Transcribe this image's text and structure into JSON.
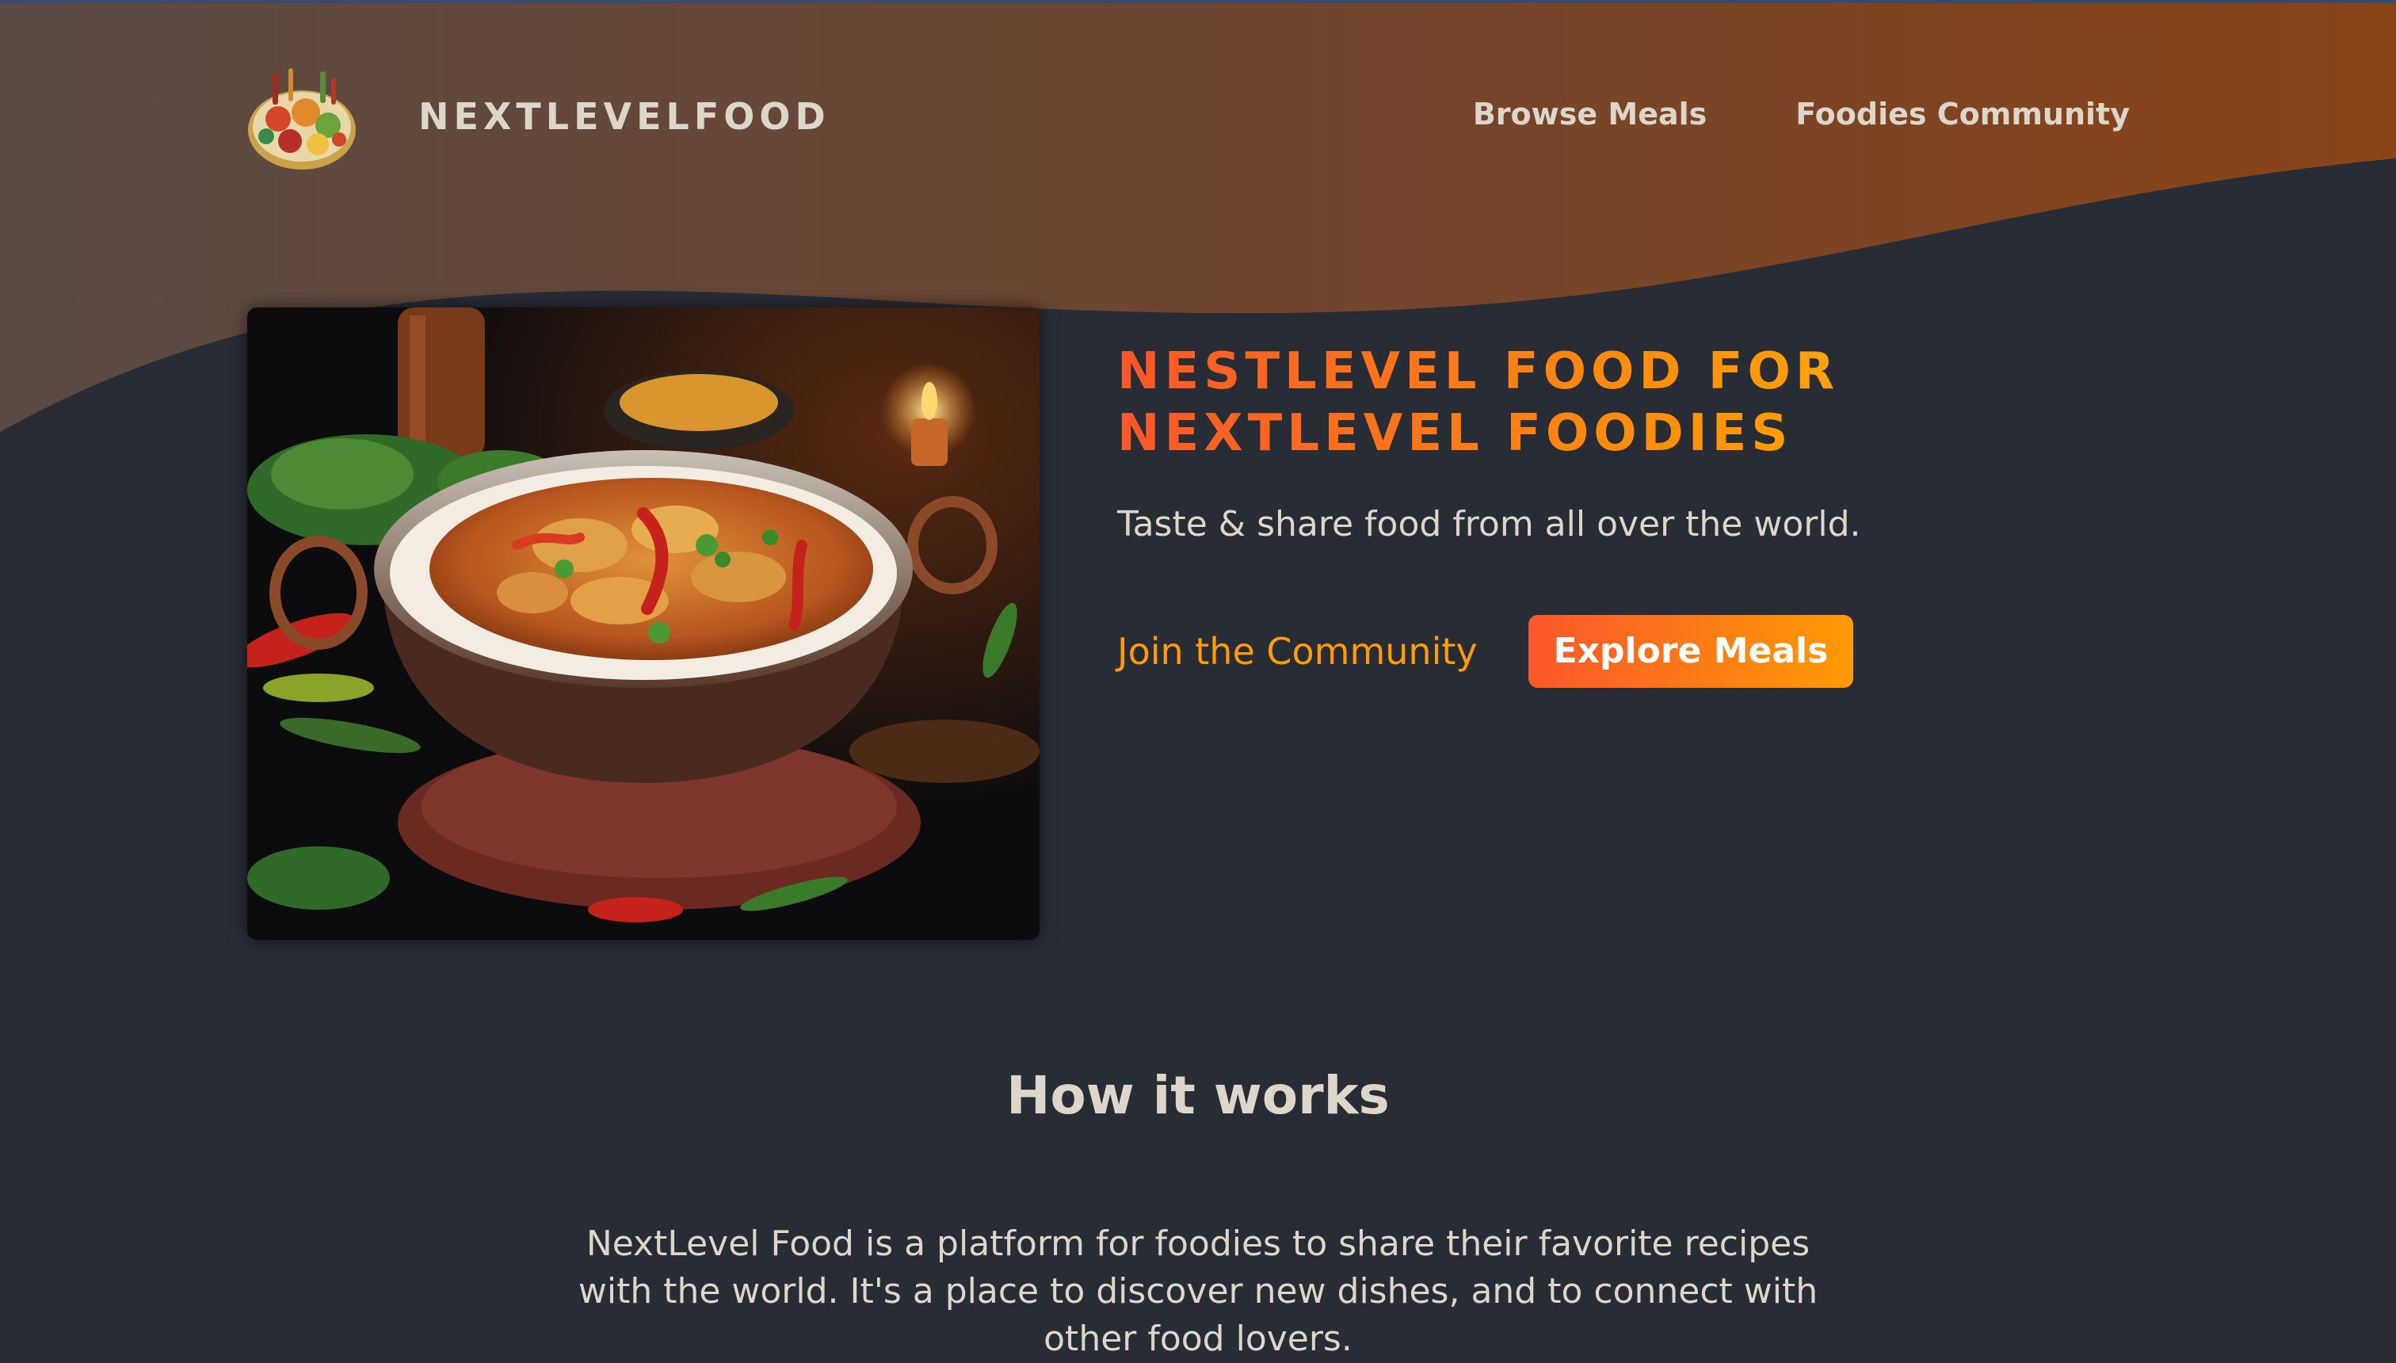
{
  "header": {
    "logo_alt": "A plate with food on it",
    "brand": "NEXTLEVELFOOD",
    "nav": [
      {
        "label": "Browse Meals"
      },
      {
        "label": "Foodies Community"
      }
    ]
  },
  "hero": {
    "image_alt": "A delicious, juicy curry dish with rice",
    "title": "NESTLEVEL FOOD FOR NEXTLEVEL FOODIES",
    "subtitle": "Taste & share food from all over the world.",
    "join_label": "Join the Community",
    "explore_label": "Explore Meals"
  },
  "how_it_works": {
    "title": "How it works",
    "text": "NextLevel Food is a platform for foodies to share their favorite recipes with the world. It's a place to discover new dishes, and to connect with other food lovers."
  },
  "colors": {
    "background": "#282c35",
    "header_gradient_start": "#5a4a44",
    "header_gradient_end": "#8a4418",
    "accent_orange": "#f9572a",
    "accent_amber": "#ff9b05",
    "text": "#ddd6cb"
  }
}
